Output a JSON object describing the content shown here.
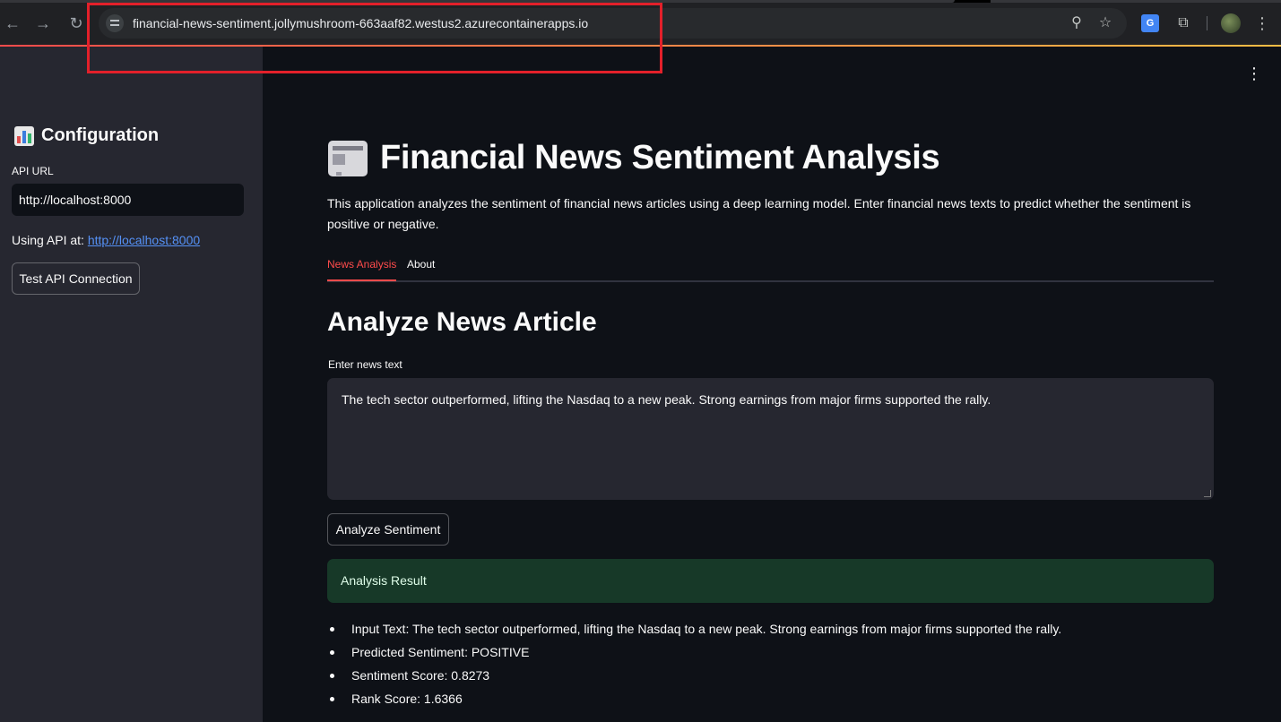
{
  "browser": {
    "url": "financial-news-sentiment.jollymushroom-663aaf82.westus2.azurecontainerapps.io",
    "translate_label": "G"
  },
  "sidebar": {
    "title": "Configuration",
    "api_url_label": "API URL",
    "api_url_value": "http://localhost:8000",
    "using_prefix": "Using API at: ",
    "using_link": "http://localhost:8000",
    "test_button": "Test API Connection"
  },
  "main": {
    "title": "Financial News Sentiment Analysis",
    "description": "This application analyzes the sentiment of financial news articles using a deep learning model. Enter financial news texts to predict whether the sentiment is positive or negative.",
    "tabs": [
      {
        "label": "News Analysis",
        "active": true
      },
      {
        "label": "About",
        "active": false
      }
    ],
    "section_heading": "Analyze News Article",
    "input_label": "Enter news text",
    "input_value": "The tech sector outperformed, lifting the Nasdaq to a new peak. Strong earnings from major firms supported the rally.",
    "analyze_button": "Analyze Sentiment",
    "result_header": "Analysis Result",
    "results": [
      "Input Text: The tech sector outperformed, lifting the Nasdaq to a new peak. Strong earnings from major firms supported the rally.",
      "Predicted Sentiment: POSITIVE",
      "Sentiment Score: 0.8273",
      "Rank Score: 1.6366"
    ]
  },
  "colors": {
    "accent": "#ff4b4b",
    "success_bg": "#173928",
    "sidebar_bg": "#262730",
    "app_bg": "#0e1117",
    "highlight": "#e3202a"
  }
}
